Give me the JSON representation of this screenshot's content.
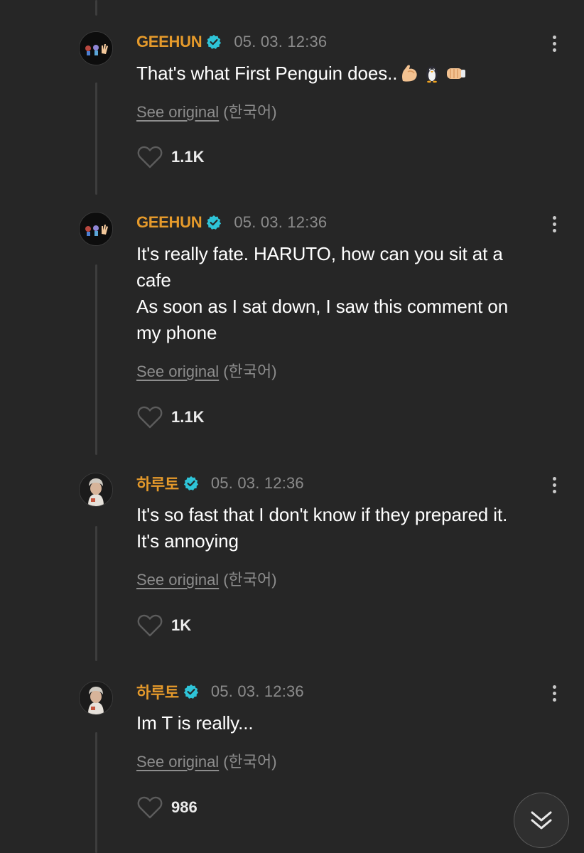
{
  "comments": [
    {
      "author": "GEEHUN",
      "timestamp": "05. 03. 12:36",
      "text": "That's what First Penguin does..",
      "emojis": [
        "flexed-biceps-emoji",
        "penguin-emoji",
        "left-facing-fist-emoji"
      ],
      "see_original": "See original",
      "original_language": "(한국어)",
      "likes": "1.1K"
    },
    {
      "author": "GEEHUN",
      "timestamp": "05. 03. 12:36",
      "text_lines": [
        "It's really fate. HARUTO, how can you sit at a",
        "cafe",
        "As soon as I sat down, I saw this comment on",
        "my phone"
      ],
      "see_original": "See original",
      "original_language": "(한국어)",
      "likes": "1.1K"
    },
    {
      "author": "하루토",
      "timestamp": "05. 03. 12:36",
      "text_lines": [
        "It's so fast that I don't know if they prepared it.",
        "It's annoying"
      ],
      "see_original": "See original",
      "original_language": "(한국어)",
      "likes": "1K"
    },
    {
      "author": "하루토",
      "timestamp": "05. 03. 12:36",
      "text": "Im T is really...",
      "see_original": "See original",
      "original_language": "(한국어)",
      "likes": "986"
    }
  ],
  "icons": {
    "verified": "verified-badge-icon",
    "more": "more-options-icon",
    "like": "heart-icon",
    "scroll": "double-chevron-down-icon"
  },
  "colors": {
    "background": "#262626",
    "author": "#e59a2b",
    "verified_badge": "#2ec4d8",
    "timestamp": "#8b8b8b",
    "thread_line": "#3d3d3d"
  }
}
